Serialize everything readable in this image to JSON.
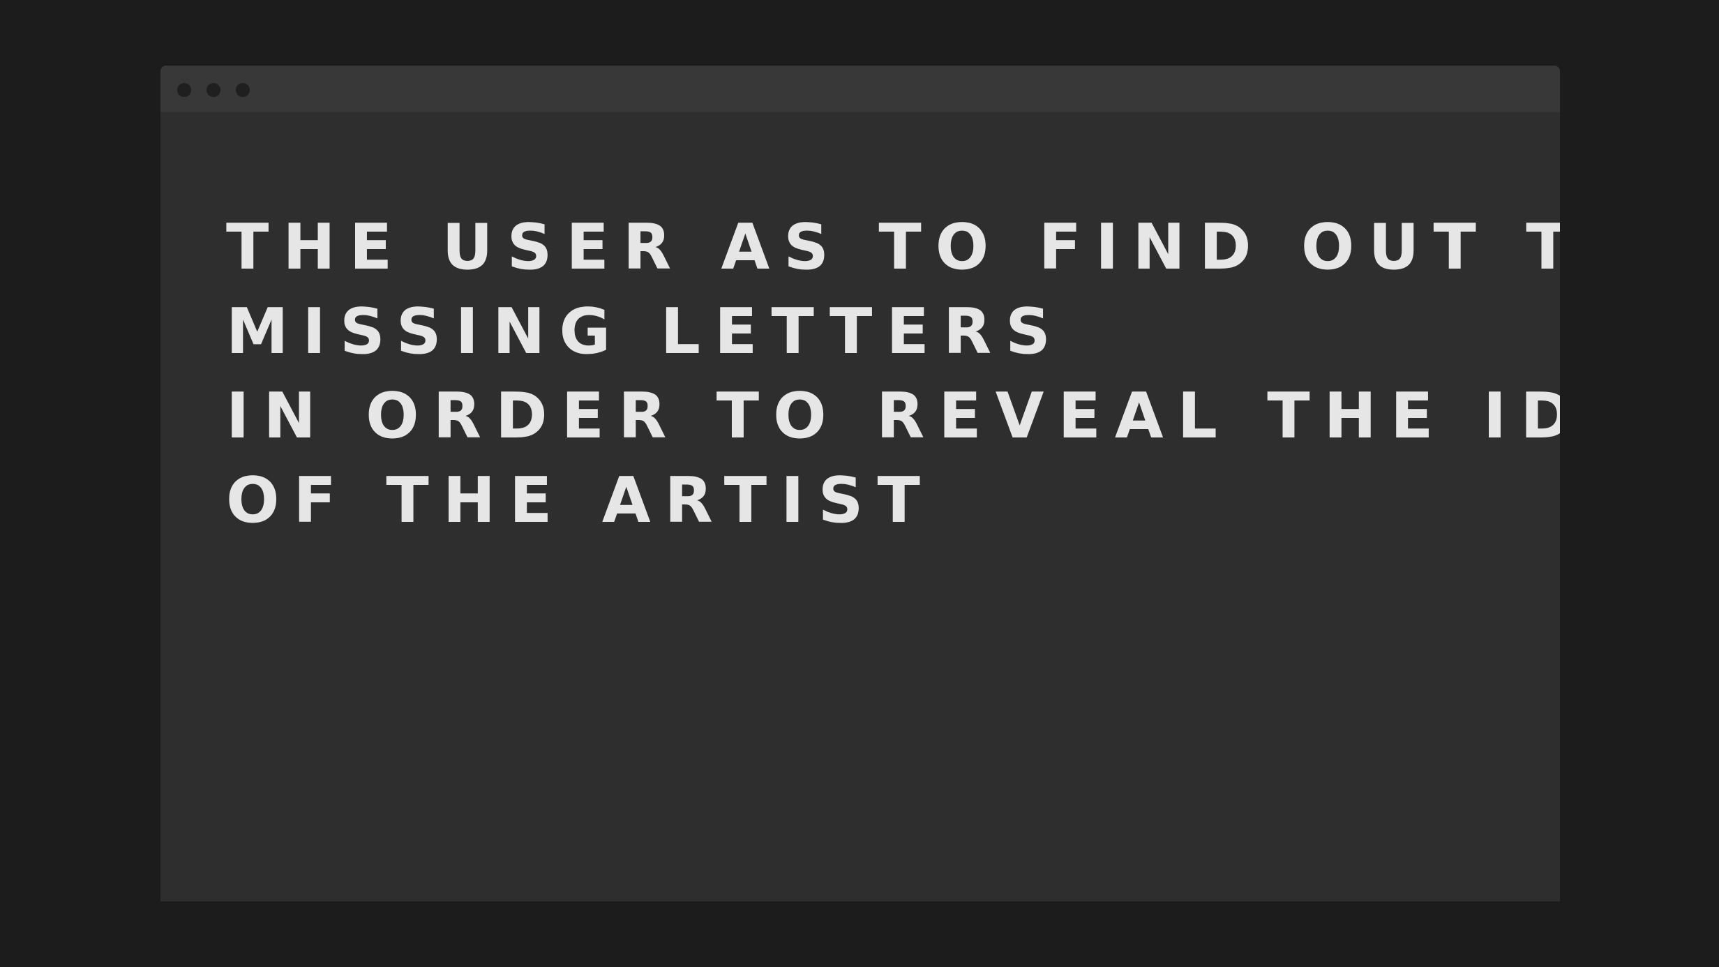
{
  "window": {
    "controls": [
      "window-dot-icon",
      "window-dot-icon",
      "window-dot-icon"
    ]
  },
  "content": {
    "lines": [
      "THE USER AS TO FIND OUT THE",
      "MISSING LETTERS",
      "IN ORDER TO REVEAL THE IDENTITY",
      "OF THE ARTIST"
    ]
  },
  "colors": {
    "page_background": "#1c1c1c",
    "window_background": "#2e2e2e",
    "titlebar_background": "#383838",
    "dot": "#1f1f1f",
    "text": "#e6e6e6"
  }
}
